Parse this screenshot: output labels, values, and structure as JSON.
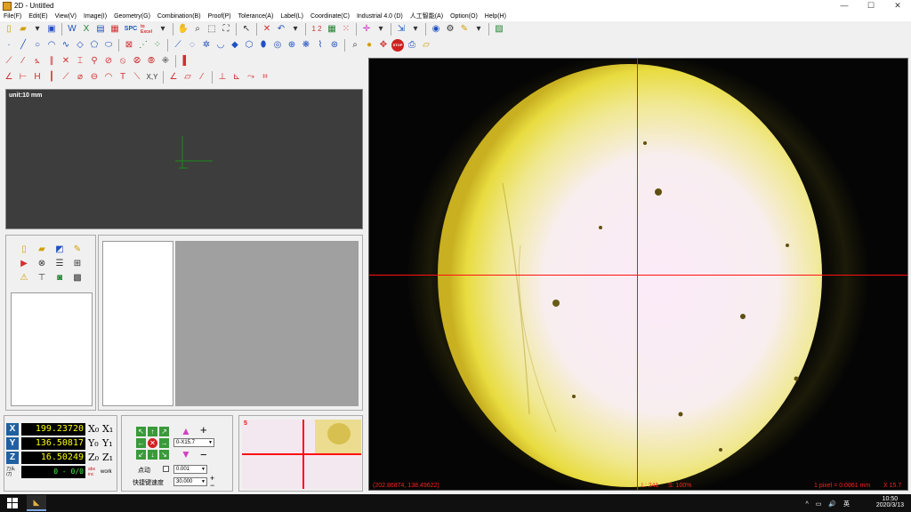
{
  "window": {
    "title": "2D - Untitled",
    "minimize": "—",
    "maximize": "☐",
    "close": "✕"
  },
  "menu": [
    "File(F)",
    "Edit(E)",
    "View(V)",
    "Image(I)",
    "Geometry(G)",
    "Combination(B)",
    "Proof(P)",
    "Tolerance(A)",
    "Label(L)",
    "Coordinate(C)",
    "Industrial 4.0 (D)",
    "人工智能(A)",
    "Option(O)",
    "Help(H)"
  ],
  "toolbar": {
    "spc_label": "SPC",
    "to_excel_label": "to Excel",
    "xy_label": "X,Y",
    "stop_label": "STOP",
    "one_two_label": "1 2"
  },
  "canvas2d": {
    "unit_label": "unit:10 mm"
  },
  "coordinates": {
    "x": {
      "axis": "X",
      "value": "199.23720",
      "zero": "X₀",
      "one": "X₁"
    },
    "y": {
      "axis": "Y",
      "value": "136.50817",
      "zero": "Y₀",
      "one": "Y₁"
    },
    "z": {
      "axis": "Z",
      "value": "16.50249",
      "zero": "Z₀",
      "one": "Z₁"
    },
    "counter_label": "刀头\n/刀",
    "counter_value": "0 - 0/0",
    "abs_label": "abs\ninc",
    "work_label": "work"
  },
  "movement": {
    "zoom_select": "0-X15.7",
    "jog_label": "点动",
    "step_select": "0.001",
    "speed_label": "快捷键速度",
    "speed_select": "30.000",
    "plus": "+",
    "minus": "−"
  },
  "preview": {
    "number": "5"
  },
  "camera": {
    "cursor_coords": "(202.86874, 138.49622)",
    "light_label": "L: 241",
    "scale_label": "S: 100%",
    "pixel_label": "1 pixel = 0.0061 mm",
    "zoom_label": "X 15.7"
  },
  "taskbar": {
    "time": "10:50",
    "date": "2020/3/13",
    "tray": "^ ▭ 🔊 英"
  },
  "colors": {
    "crosshair": "#ff1010",
    "coord_value": "#ffff00",
    "axis_bg": "#2060a0"
  }
}
